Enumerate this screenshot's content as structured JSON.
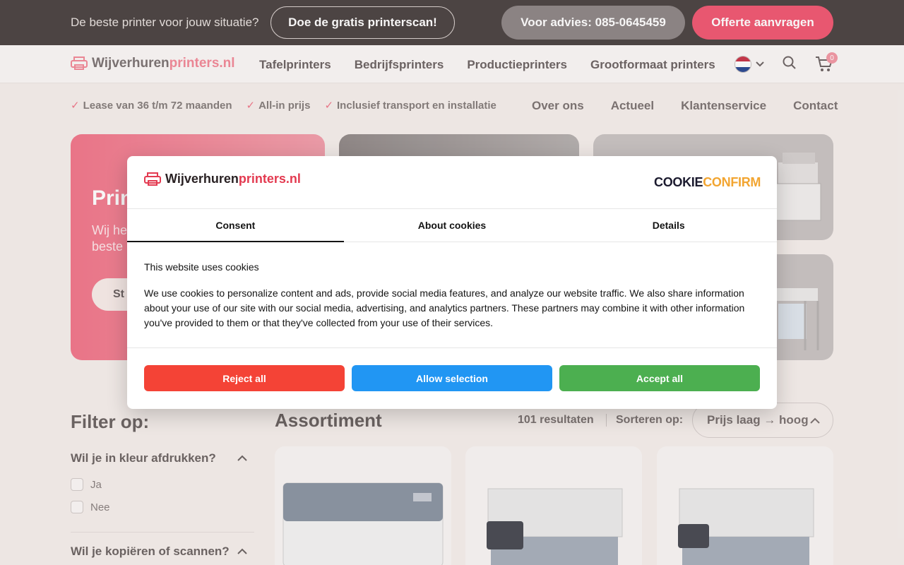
{
  "topbar": {
    "question": "De beste printer voor jouw situatie?",
    "scan_button": "Doe de gratis printerscan!",
    "advice_button": "Voor advies: 085-0645459",
    "quote_button": "Offerte aanvragen"
  },
  "logo": {
    "part1": "Wijverhuren",
    "part2": "printers.nl"
  },
  "nav": {
    "links": [
      "Tafelprinters",
      "Bedrijfsprinters",
      "Productieprinters",
      "Grootformaat printers"
    ],
    "cart_count": "0"
  },
  "usp": {
    "items": [
      "Lease van 36 t/m 72 maanden",
      "All-in prijs",
      "Inclusief transport en installatie"
    ]
  },
  "secondary_nav": [
    "Over ons",
    "Actueel",
    "Klantenservice",
    "Contact"
  ],
  "hero": {
    "title": "Prin",
    "subtitle_line1": "Wij he",
    "subtitle_line2": "beste",
    "button": "St"
  },
  "filters": {
    "title": "Filter op:",
    "groups": [
      {
        "label": "Wil je in kleur afdrukken?",
        "options": [
          "Ja",
          "Nee"
        ]
      },
      {
        "label": "Wil je kopiëren of scannen?"
      }
    ]
  },
  "assortment": {
    "title": "Assortiment",
    "results": "101 resultaten",
    "sort_label": "Sorteren op:",
    "sort_value": "Prijs laag → hoog"
  },
  "cookie": {
    "brand_part1": "COOKIE",
    "brand_part2": "CONFIRM",
    "tabs": [
      "Consent",
      "About cookies",
      "Details"
    ],
    "title": "This website uses cookies",
    "body": "We use cookies to personalize content and ads, provide social media features, and analyze our website traffic. We also share information about your use of our site with our social media, advertising, and analytics partners. These partners may combine it with other information you've provided to them or that they've collected from your use of their services.",
    "reject": "Reject all",
    "allow": "Allow selection",
    "accept": "Accept all"
  },
  "colors": {
    "accent_pink": "#f05a74",
    "reject": "#f44336",
    "allow": "#2196f3",
    "accept": "#4caf50"
  },
  "icons": [
    "printer-logo-icon",
    "flag-nl-icon",
    "chevron-down-icon",
    "search-icon",
    "cart-icon",
    "check-icon",
    "chevron-up-icon"
  ]
}
